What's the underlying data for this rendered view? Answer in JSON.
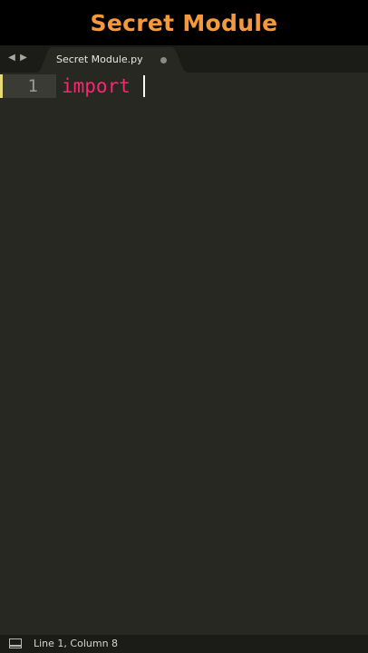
{
  "header": {
    "title": "Secret Module"
  },
  "tabbar": {
    "back_icon": "triangle-left",
    "forward_icon": "triangle-right",
    "tabs": [
      {
        "label": "Secret Module.py",
        "modified_icon": "dot",
        "active": true
      }
    ]
  },
  "editor": {
    "lines": [
      {
        "number": "1",
        "code": "import "
      }
    ],
    "keyword_color": "#F92672"
  },
  "status_bar": {
    "panel_icon": "panel-toggle",
    "position_text": "Line 1, Column 8"
  },
  "colors": {
    "title": "#F59A3C",
    "editor_background": "#272822",
    "line_highlight": "#3a3b33",
    "line_marker": "#e6db74"
  }
}
